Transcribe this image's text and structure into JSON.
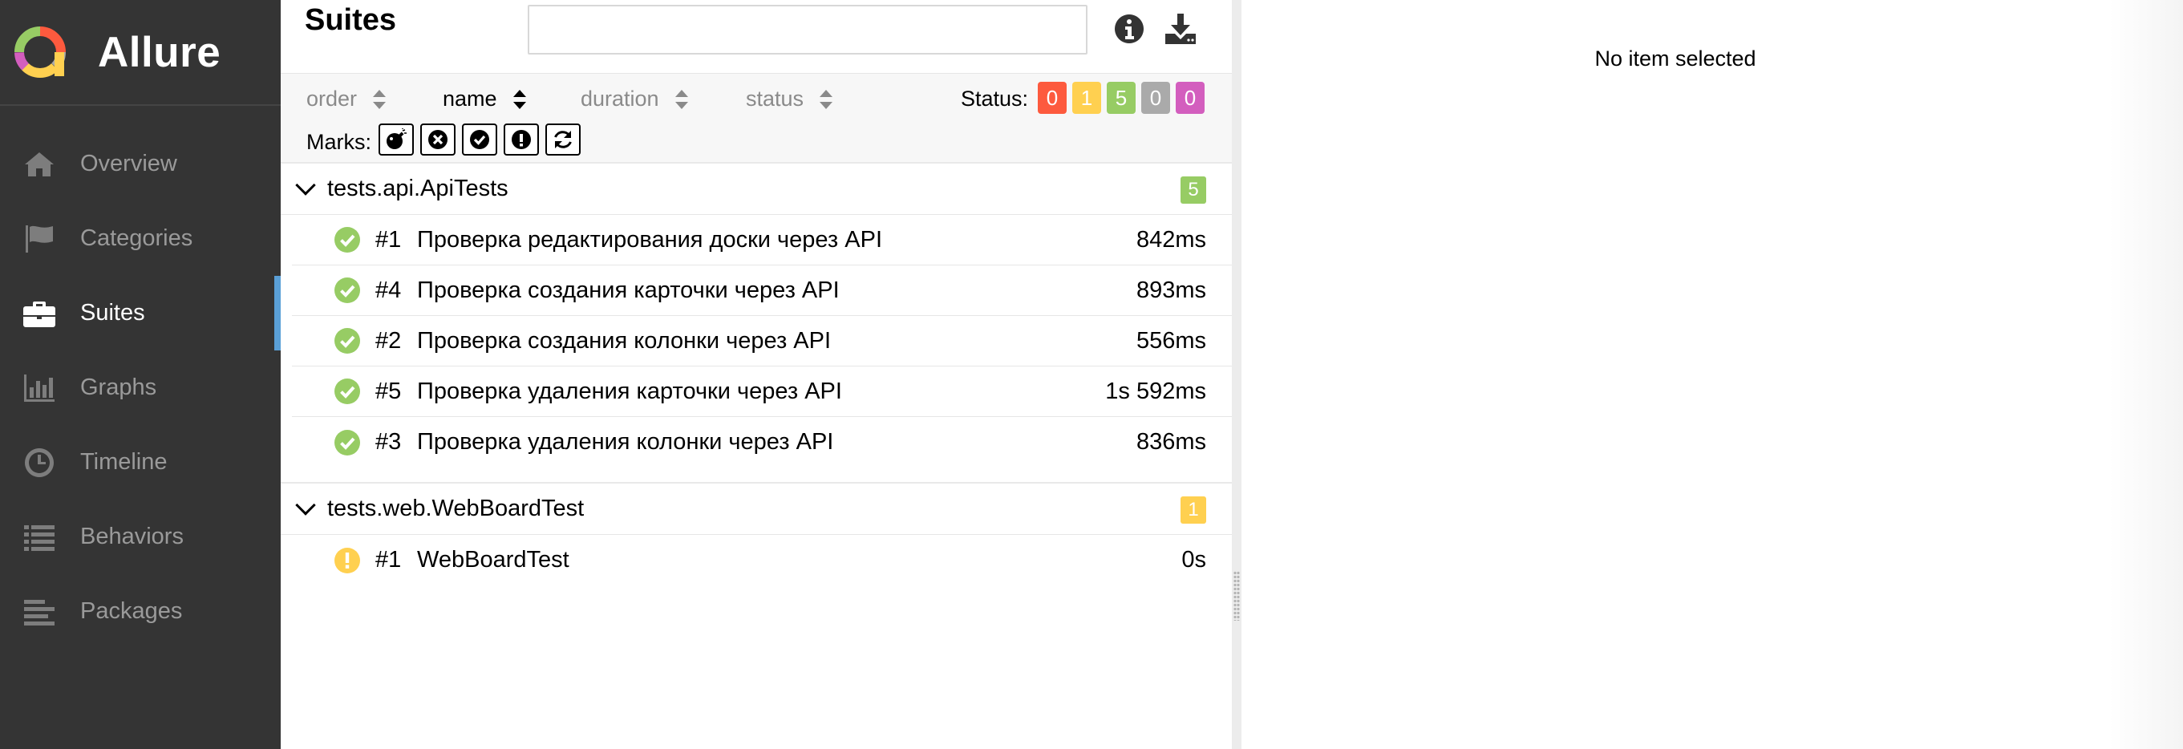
{
  "app": {
    "name": "Allure"
  },
  "colors": {
    "sidebar_bg": "#343434",
    "active_indicator": "#5a9fd6",
    "failed": "#fd5a3e",
    "broken": "#ffd050",
    "passed": "#97cc64",
    "skipped": "#aaaaaa",
    "unknown": "#d35ebe"
  },
  "sidebar": {
    "items": [
      {
        "label": "Overview",
        "icon": "home-icon",
        "active": false
      },
      {
        "label": "Categories",
        "icon": "flag-icon",
        "active": false
      },
      {
        "label": "Suites",
        "icon": "briefcase-icon",
        "active": true
      },
      {
        "label": "Graphs",
        "icon": "bar-chart-icon",
        "active": false
      },
      {
        "label": "Timeline",
        "icon": "clock-icon",
        "active": false
      },
      {
        "label": "Behaviors",
        "icon": "list-icon",
        "active": false
      },
      {
        "label": "Packages",
        "icon": "align-left-icon",
        "active": false
      }
    ]
  },
  "suites": {
    "title": "Suites",
    "search": {
      "value": "",
      "placeholder": ""
    },
    "header_icons": [
      "info-icon",
      "download-icon"
    ],
    "sorters": [
      {
        "label": "order",
        "active": false
      },
      {
        "label": "name",
        "active": true
      },
      {
        "label": "duration",
        "active": false
      },
      {
        "label": "status",
        "active": false
      }
    ],
    "status_label": "Status:",
    "status_counts": [
      {
        "name": "failed",
        "count": "0",
        "color": "#fd5a3e"
      },
      {
        "name": "broken",
        "count": "1",
        "color": "#ffd050"
      },
      {
        "name": "passed",
        "count": "5",
        "color": "#97cc64"
      },
      {
        "name": "skipped",
        "count": "0",
        "color": "#aaaaaa"
      },
      {
        "name": "unknown",
        "count": "0",
        "color": "#d35ebe"
      }
    ],
    "marks_label": "Marks:",
    "marks": [
      "bomb-icon",
      "times-circle-icon",
      "check-circle-icon",
      "exclamation-circle-icon",
      "refresh-icon"
    ],
    "groups": [
      {
        "name": "tests.api.ApiTests",
        "count": "5",
        "count_color": "#97cc64",
        "tests": [
          {
            "num": "#1",
            "name": "Проверка редактирования доски через API",
            "duration": "842ms",
            "status": "passed"
          },
          {
            "num": "#4",
            "name": "Проверка создания карточки через API",
            "duration": "893ms",
            "status": "passed"
          },
          {
            "num": "#2",
            "name": "Проверка создания колонки через API",
            "duration": "556ms",
            "status": "passed"
          },
          {
            "num": "#5",
            "name": "Проверка удаления карточки через API",
            "duration": "1s 592ms",
            "status": "passed"
          },
          {
            "num": "#3",
            "name": "Проверка удаления колонки через API",
            "duration": "836ms",
            "status": "passed"
          }
        ]
      },
      {
        "name": "tests.web.WebBoardTest",
        "count": "1",
        "count_color": "#ffd050",
        "tests": [
          {
            "num": "#1",
            "name": "WebBoardTest",
            "duration": "0s",
            "status": "broken"
          }
        ]
      }
    ]
  },
  "detail": {
    "empty_message": "No item selected"
  }
}
